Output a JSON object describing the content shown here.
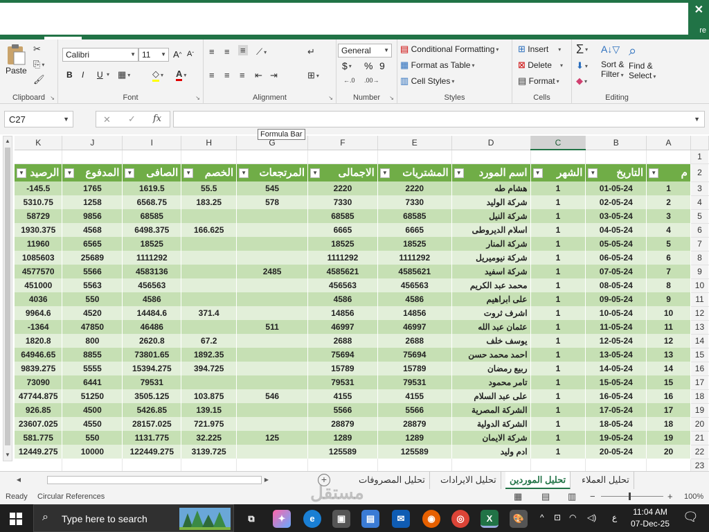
{
  "titlebar": {
    "close": "✕",
    "share_fragment": "re"
  },
  "ribbon": {
    "clipboard": {
      "label": "Clipboard",
      "paste": "Paste"
    },
    "font": {
      "label": "Font",
      "name": "Calibri",
      "size": "11",
      "bold": "B",
      "italic": "I",
      "underline": "U",
      "grow": "A",
      "shrink": "A"
    },
    "alignment": {
      "label": "Alignment"
    },
    "number": {
      "label": "Number",
      "format": "General",
      "currency": "$",
      "percent": "%",
      "comma": "9"
    },
    "styles": {
      "label": "Styles",
      "conditional": "Conditional Formatting",
      "format_table": "Format as Table",
      "cell_styles": "Cell Styles"
    },
    "cells": {
      "label": "Cells",
      "insert": "Insert",
      "delete": "Delete",
      "format": "Format"
    },
    "editing": {
      "label": "Editing",
      "sort": "Sort &",
      "sort2": "Filter",
      "find": "Find &",
      "find2": "Select"
    }
  },
  "formula_bar": {
    "name_box": "C27",
    "cancel": "✕",
    "enter": "✓",
    "fx": "fx",
    "tooltip": "Formula Bar",
    "value": ""
  },
  "columns": [
    "K",
    "J",
    "I",
    "H",
    "G",
    "F",
    "E",
    "D",
    "C",
    "B",
    "A"
  ],
  "selected_column": "C",
  "headers": [
    "الرصيد",
    "المدفوع",
    "الصافى",
    "الخصم",
    "المرتجعات",
    "الاجمالى",
    "المشتريات",
    "اسم المورد",
    "الشهر",
    "التاريخ",
    "م"
  ],
  "rows": [
    [
      "-145.5",
      "1765",
      "1619.5",
      "55.5",
      "545",
      "2220",
      "2220",
      "هشام طه",
      "1",
      "01-05-24",
      "1"
    ],
    [
      "5310.75",
      "1258",
      "6568.75",
      "183.25",
      "578",
      "7330",
      "7330",
      "شركة الوليد",
      "1",
      "02-05-24",
      "2"
    ],
    [
      "58729",
      "9856",
      "68585",
      "",
      "",
      "68585",
      "68585",
      "شركة النيل",
      "1",
      "03-05-24",
      "3"
    ],
    [
      "1930.375",
      "4568",
      "6498.375",
      "166.625",
      "",
      "6665",
      "6665",
      "اسلام الديروطى",
      "1",
      "04-05-24",
      "4"
    ],
    [
      "11960",
      "6565",
      "18525",
      "",
      "",
      "18525",
      "18525",
      "شركة المنار",
      "1",
      "05-05-24",
      "5"
    ],
    [
      "1085603",
      "25689",
      "1111292",
      "",
      "",
      "1111292",
      "1111292",
      "شركة نيوميريل",
      "1",
      "06-05-24",
      "6"
    ],
    [
      "4577570",
      "5566",
      "4583136",
      "",
      "2485",
      "4585621",
      "4585621",
      "شركة اسفيد",
      "1",
      "07-05-24",
      "7"
    ],
    [
      "451000",
      "5563",
      "456563",
      "",
      "",
      "456563",
      "456563",
      "محمد عبد الكريم",
      "1",
      "08-05-24",
      "8"
    ],
    [
      "4036",
      "550",
      "4586",
      "",
      "",
      "4586",
      "4586",
      "على ابراهيم",
      "1",
      "09-05-24",
      "9"
    ],
    [
      "9964.6",
      "4520",
      "14484.6",
      "371.4",
      "",
      "14856",
      "14856",
      "اشرف ثروت",
      "1",
      "10-05-24",
      "10"
    ],
    [
      "-1364",
      "47850",
      "46486",
      "",
      "511",
      "46997",
      "46997",
      "عثمان عبد الله",
      "1",
      "11-05-24",
      "11"
    ],
    [
      "1820.8",
      "800",
      "2620.8",
      "67.2",
      "",
      "2688",
      "2688",
      "يوسف خلف",
      "1",
      "12-05-24",
      "12"
    ],
    [
      "64946.65",
      "8855",
      "73801.65",
      "1892.35",
      "",
      "75694",
      "75694",
      "احمد محمد حسن",
      "1",
      "13-05-24",
      "13"
    ],
    [
      "9839.275",
      "5555",
      "15394.275",
      "394.725",
      "",
      "15789",
      "15789",
      "ربيع رمضان",
      "1",
      "14-05-24",
      "14"
    ],
    [
      "73090",
      "6441",
      "79531",
      "",
      "",
      "79531",
      "79531",
      "تامر محمود",
      "1",
      "15-05-24",
      "15"
    ],
    [
      "47744.875",
      "51250",
      "3505.125",
      "103.875",
      "546",
      "4155",
      "4155",
      "على عبد السلام",
      "1",
      "16-05-24",
      "16"
    ],
    [
      "926.85",
      "4500",
      "5426.85",
      "139.15",
      "",
      "5566",
      "5566",
      "الشركة المصرية",
      "1",
      "17-05-24",
      "17"
    ],
    [
      "23607.025",
      "4550",
      "28157.025",
      "721.975",
      "",
      "28879",
      "28879",
      "الشركة الدولية",
      "1",
      "18-05-24",
      "18"
    ],
    [
      "581.775",
      "550",
      "1131.775",
      "32.225",
      "125",
      "1289",
      "1289",
      "شركة الايمان",
      "1",
      "19-05-24",
      "19"
    ],
    [
      "12449.275",
      "10000",
      "122449.275",
      "3139.725",
      "",
      "125589",
      "125589",
      "ادم وليد",
      "1",
      "20-05-24",
      "20"
    ]
  ],
  "row_numbers": [
    "1",
    "2",
    "3",
    "4",
    "5",
    "6",
    "7",
    "8",
    "9",
    "10",
    "11",
    "12",
    "13",
    "14",
    "15",
    "16",
    "17",
    "18",
    "19",
    "20",
    "21",
    "22",
    "23"
  ],
  "sheet_tabs": [
    "تحليل المصروفات",
    "تحليل الايرادات",
    "تحليل الموردين",
    "تحليل العملاء"
  ],
  "active_tab": "تحليل الموردين",
  "status": {
    "ready": "Ready",
    "circular": "Circular References",
    "zoom": "100%"
  },
  "watermark": "مستقل",
  "taskbar": {
    "search_placeholder": "Type here to search",
    "time": "11:04 AM",
    "date": "07-Dec-25",
    "lang": "ع"
  },
  "colors": {
    "excel_green": "#217346",
    "header_green": "#70ad47",
    "band_dark": "#c6e0b4",
    "band_light": "#e2efd9"
  }
}
